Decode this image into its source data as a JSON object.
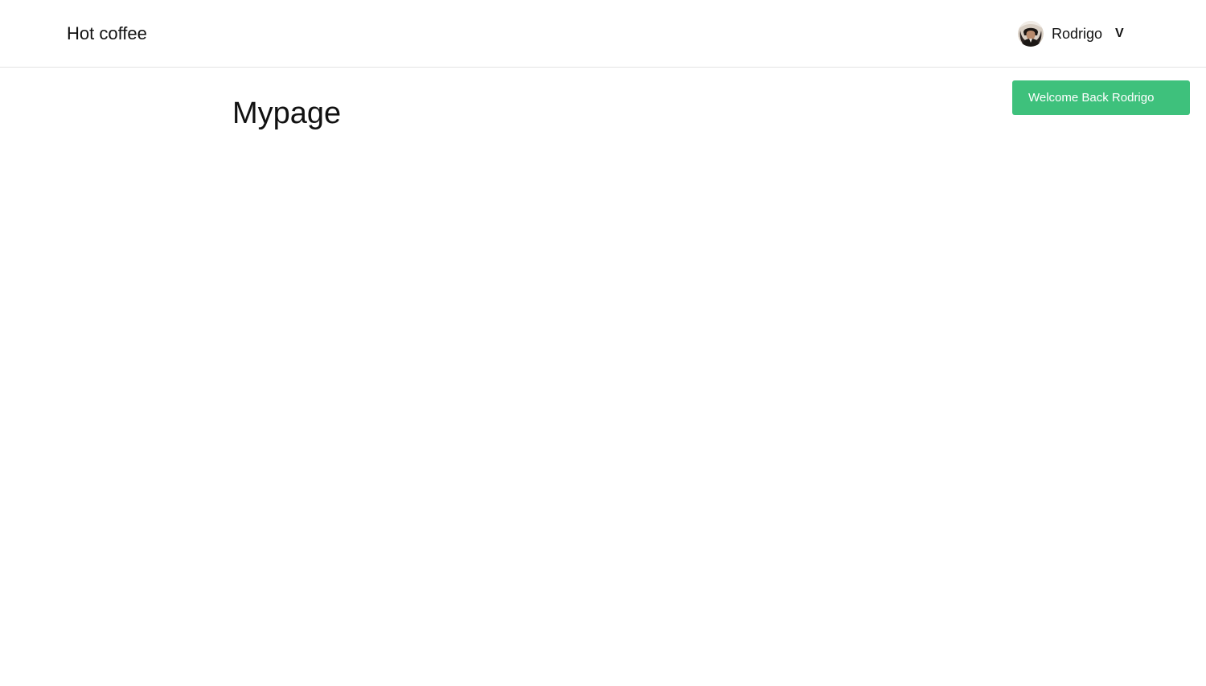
{
  "navbar": {
    "brand": "Hot coffee",
    "user": {
      "name": "Rodrigo",
      "dropdown_indicator": "V",
      "avatar_icon": "user-avatar-photo"
    }
  },
  "main": {
    "title": "Mypage"
  },
  "notification": {
    "message": "Welcome Back Rodrigo",
    "color": "#3ec17c"
  }
}
